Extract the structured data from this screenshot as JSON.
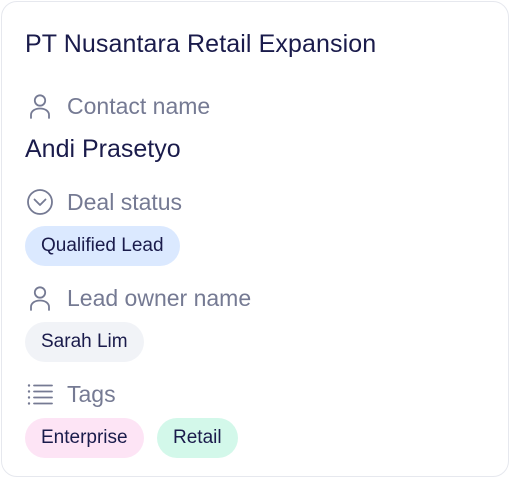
{
  "record": {
    "title": "PT Nusantara Retail Expansion"
  },
  "fields": {
    "contact": {
      "label": "Contact name",
      "icon": "person-icon",
      "value": "Andi Prasetyo"
    },
    "deal_status": {
      "label": "Deal status",
      "icon": "chevron-circle-icon",
      "value": "Qualified Lead",
      "color": "#dbe9ff"
    },
    "lead_owner": {
      "label": "Lead owner name",
      "icon": "person-icon",
      "value": "Sarah Lim",
      "color": "#f1f3f7"
    },
    "tags": {
      "label": "Tags",
      "icon": "list-icon",
      "items": [
        {
          "label": "Enterprise",
          "color": "#fde4f5"
        },
        {
          "label": "Retail",
          "color": "#d3f8ea"
        }
      ]
    }
  },
  "colors": {
    "title": "#1a1b4b",
    "label": "#757a93",
    "border": "#e6e8ee"
  }
}
